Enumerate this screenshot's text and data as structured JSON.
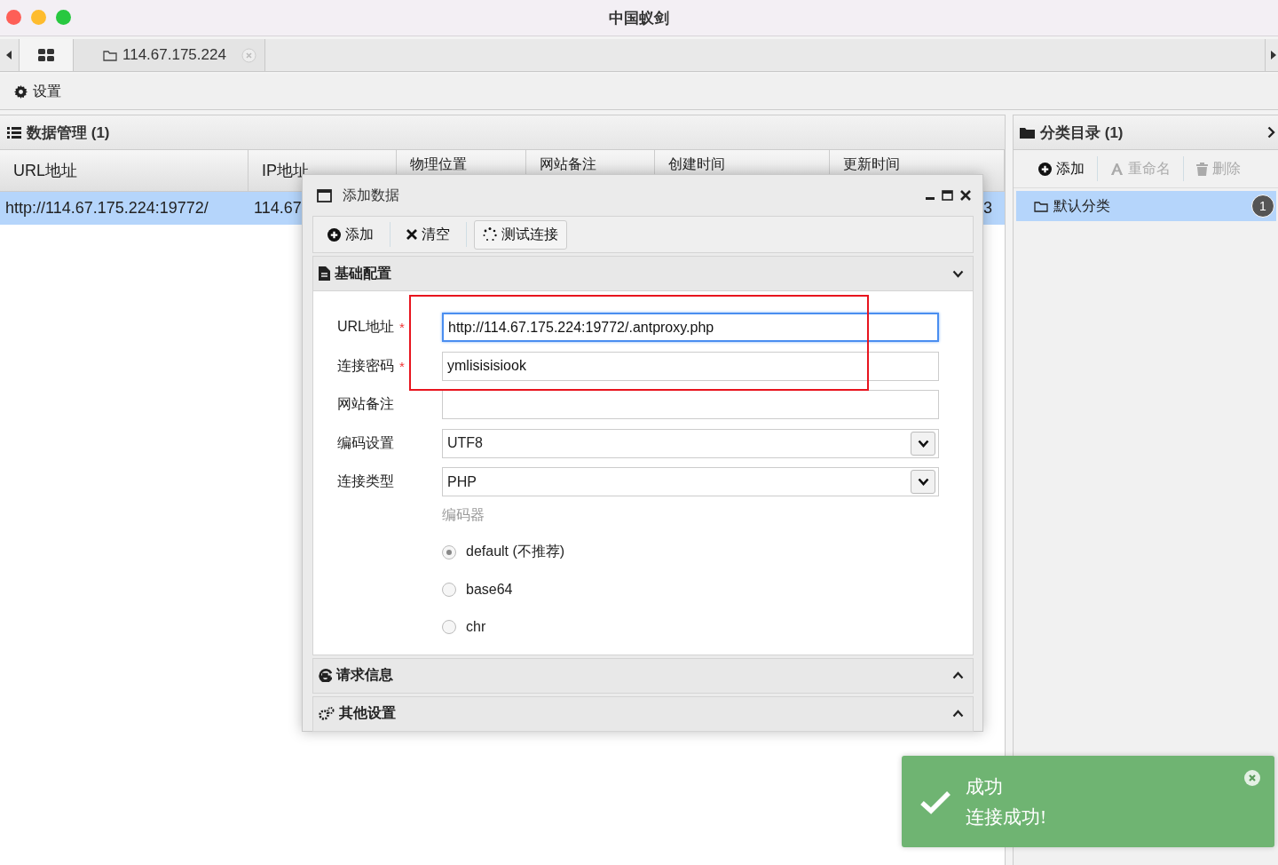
{
  "window": {
    "title": "中国蚁剑"
  },
  "tabs": [
    {
      "kind": "home",
      "selected": true
    },
    {
      "kind": "folder",
      "label": "114.67.175.224",
      "selected": false
    }
  ],
  "toolbar": {
    "settings": "设置"
  },
  "data_panel": {
    "title": "数据管理 (1)",
    "columns": [
      "URL地址",
      "IP地址",
      "物理位置",
      "网站备注",
      "创建时间",
      "更新时间"
    ],
    "rows": [
      {
        "url": "http://114.67.175.224:19772/",
        "ip": "114.67",
        "update_time": "3",
        "selected": true
      }
    ]
  },
  "category_panel": {
    "title": "分类目录 (1)",
    "actions": [
      {
        "kind": "add",
        "label": "添加",
        "disabled": false
      },
      {
        "kind": "rename",
        "label": "重命名",
        "disabled": true
      },
      {
        "kind": "delete",
        "label": "删除",
        "disabled": true
      }
    ],
    "items": [
      {
        "label": "默认分类",
        "count": "1",
        "selected": true
      }
    ]
  },
  "dialog": {
    "title": "添加数据",
    "toolbar": [
      {
        "kind": "add",
        "label": "添加"
      },
      {
        "kind": "clear",
        "label": "清空"
      },
      {
        "kind": "test",
        "label": "测试连接"
      }
    ],
    "sections": [
      {
        "kind": "doc",
        "title": "基础配置",
        "expanded": true
      },
      {
        "kind": "request",
        "title": "请求信息",
        "expanded": false
      },
      {
        "kind": "gears",
        "title": "其他设置",
        "expanded": false
      }
    ],
    "fields": [
      {
        "kind": "text",
        "label": "URL地址",
        "required_mark": "*",
        "focused": true,
        "value": "http://114.67.175.224:19772/.antproxy.php"
      },
      {
        "kind": "text",
        "label": "连接密码",
        "required_mark": "*",
        "focused": false,
        "value": "ymlisisisiook"
      },
      {
        "kind": "text",
        "label": "网站备注",
        "focused": false
      },
      {
        "kind": "select",
        "label": "编码设置",
        "value": "UTF8"
      },
      {
        "kind": "select",
        "label": "连接类型",
        "value": "PHP"
      }
    ],
    "encoder": {
      "label": "编码器",
      "options": [
        {
          "label": "default (不推荐)",
          "selected": true
        },
        {
          "label": "base64",
          "selected": false
        },
        {
          "label": "chr",
          "selected": false
        }
      ]
    }
  },
  "toast": {
    "title": "成功",
    "message": "连接成功!"
  }
}
